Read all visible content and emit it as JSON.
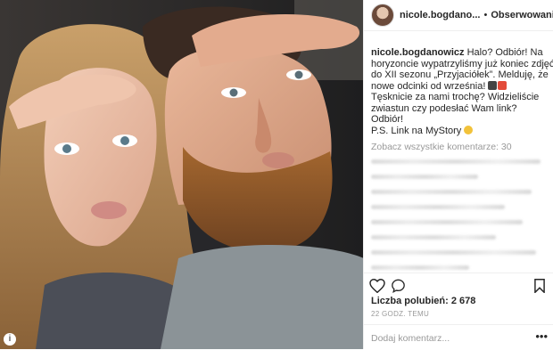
{
  "header": {
    "username": "nicole.bogdano...",
    "separator": "•",
    "follow_label": "Obserwowanie"
  },
  "caption": {
    "username": "nicole.bogdanowicz",
    "lines": [
      "Halo? Odbiór! Na",
      "horyzoncie wypatrzyliśmy już koniec zdjęć",
      "do XII sezonu „Przyjaciółek”. Melduję, że",
      "nowe odcinki od września!",
      "Tęsknicie za nami trochę? Widzieliście",
      "zwiastun czy podesłać Wam link?",
      "Odbiór!",
      "P.S. Link na MyStory"
    ]
  },
  "comments": {
    "view_all": "Zobacz wszystkie komentarze: 30"
  },
  "actions": {
    "like_icon": "heart-icon",
    "comment_icon": "comment-icon",
    "save_icon": "bookmark-icon"
  },
  "likes": {
    "text": "Liczba polubień: 2 678"
  },
  "timestamp": "22 GODZ. TEMU",
  "add_comment": {
    "placeholder": "Dodaj komentarz...",
    "more": "•••"
  },
  "photo": {
    "badge": "i"
  }
}
